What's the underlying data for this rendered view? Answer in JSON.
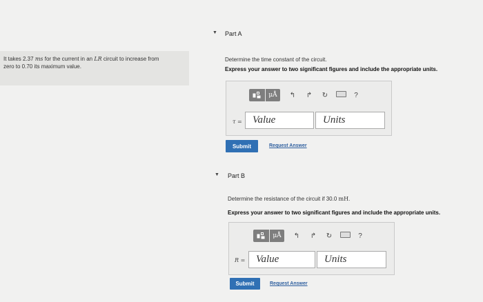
{
  "problem": {
    "line1_pre": "It takes 2.37 ",
    "unit_ms": "ms",
    "line1_mid": " for the current in an ",
    "circuit": "LR",
    "line1_post": " circuit to increase from",
    "line2": "zero to 0.70 its maximum value."
  },
  "part_a": {
    "title": "Part A",
    "question": "Determine the time constant of the circuit.",
    "instruction": "Express your answer to two significant figures and include the appropriate units.",
    "variable": "τ =",
    "value_placeholder": "Value",
    "units_placeholder": "Units",
    "submit_label": "Submit",
    "request_label": "Request Answer"
  },
  "part_b": {
    "title": "Part B",
    "question_pre": "Determine the resistance of the circuit if 30.0 ",
    "question_unit": "mH",
    "question_post": ".",
    "instruction": "Express your answer to two significant figures and include the appropriate units.",
    "variable": "R =",
    "value_placeholder": "Value",
    "units_placeholder": "Units",
    "submit_label": "Submit",
    "request_label": "Request Answer"
  },
  "toolbar": {
    "mu_label": "μÅ",
    "help_label": "?",
    "icons": [
      "templates-icon",
      "units-icon",
      "undo-icon",
      "redo-icon",
      "reset-icon",
      "keyboard-icon",
      "help-icon"
    ]
  },
  "colors": {
    "submit": "#3070b4",
    "link": "#2d5e9e",
    "toolbar": "#7e7e7e"
  }
}
